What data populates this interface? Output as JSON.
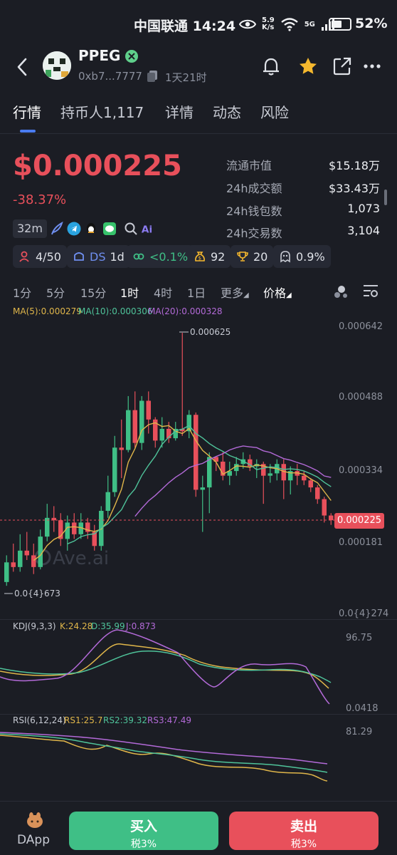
{
  "status_bar": {
    "carrier_time": "中国联通 14:24",
    "net_speed_top": "5.9",
    "net_speed_bottom": "K/s",
    "network": "5G",
    "battery": "52%"
  },
  "header": {
    "token_name": "PPEG",
    "address": "0xb7...7777",
    "age": "1天21时",
    "icons": [
      "back-icon",
      "bell-icon",
      "star-icon",
      "share-icon",
      "more-icon"
    ],
    "star_color": "#f5b82e"
  },
  "tabs": [
    {
      "label": "行情",
      "active": true
    },
    {
      "label": "持币人1,117",
      "active": false
    },
    {
      "label": "详情",
      "active": false
    },
    {
      "label": "动态",
      "active": false
    },
    {
      "label": "风险",
      "active": false
    }
  ],
  "price": {
    "value": "$0.000225",
    "change": "-38.37%",
    "color_down": "#e8505b",
    "color_up": "#3fbf86"
  },
  "stats": [
    {
      "label": "流通市值",
      "value": "$15.18万"
    },
    {
      "label": "24h成交额",
      "value": "$33.43万"
    },
    {
      "label": "24h钱包数",
      "value": "1,073"
    },
    {
      "label": "24h交易数",
      "value": "3,104"
    }
  ],
  "timeframe_badge": "32m",
  "social_icons": [
    "feather-icon",
    "telegram-icon",
    "qq-icon",
    "wechat-icon",
    "search-icon",
    "ai-icon"
  ],
  "chips": [
    {
      "icon": "holder-icon",
      "text": "4/50"
    },
    {
      "icon": "dev-icon",
      "text": "DS",
      "extra": "1d"
    },
    {
      "icon": "link-icon",
      "text": "<0.1%"
    },
    {
      "icon": "money-bag-icon",
      "text": "92"
    },
    {
      "icon": "trophy-icon",
      "text": "20"
    },
    {
      "icon": "ghost-icon",
      "text": "0.9%"
    }
  ],
  "intervals": [
    {
      "label": "1分",
      "active": false
    },
    {
      "label": "5分",
      "active": false
    },
    {
      "label": "15分",
      "active": false
    },
    {
      "label": "1时",
      "active": true
    },
    {
      "label": "4时",
      "active": false
    },
    {
      "label": "1日",
      "active": false
    },
    {
      "label": "更多",
      "active": false
    },
    {
      "label": "价格",
      "active": true
    }
  ],
  "ma_legend": {
    "ma5": "MA(5):0.000279",
    "ma10": "MA(10):0.000306",
    "ma20": "MA(20):0.000328",
    "ma5_color": "#e0b64a",
    "ma10_color": "#4fc39a",
    "ma20_color": "#b36ad8"
  },
  "watermark": "Ave.ai",
  "kdj_legend": {
    "title": "KDJ(9,3,3)",
    "k": "K:24.28",
    "d": "D:35.99",
    "j": "J:0.873"
  },
  "kdj_axis": {
    "top": "96.75",
    "bottom": "0.0418"
  },
  "rsi_legend": {
    "title": "RSI(6,12,24)",
    "rs1": "RS1:25.7",
    "rs2": "RS2:39.32",
    "rs3": "RS3:47.49"
  },
  "rsi_axis": {
    "top": "81.29"
  },
  "bottom": {
    "dapp": "DApp",
    "buy": "买入",
    "buy_tax": "税3%",
    "sell": "卖出",
    "sell_tax": "税3%",
    "buy_color": "#3fbf86",
    "sell_color": "#e8505b"
  },
  "chart_data": {
    "type": "candlestick",
    "y_axis_labels": [
      "0.000642",
      "0.000488",
      "0.000334",
      "0.000181",
      "0.0{4}274"
    ],
    "ylim": [
      2.74e-05,
      0.000642
    ],
    "high_label": "0.000625",
    "low_label": "0.0{4}673",
    "current_price_label": "0.000225",
    "candles": [
      [
        9.3e-05,
        0.000135,
        0.00015,
        8.5e-05
      ],
      [
        0.000135,
        0.000125,
        0.000175,
        0.000115
      ],
      [
        0.000125,
        0.00016,
        0.000195,
        0.000115
      ],
      [
        0.00016,
        0.00015,
        0.0002,
        0.00014
      ],
      [
        0.00015,
        0.000125,
        0.000175,
        0.00011
      ],
      [
        0.000125,
        0.00019,
        0.000205,
        0.00012
      ],
      [
        0.00019,
        0.00023,
        0.00026,
        0.00018
      ],
      [
        0.00023,
        0.000225,
        0.000255,
        0.0002
      ],
      [
        0.000225,
        0.000185,
        0.00024,
        0.00017
      ],
      [
        0.000185,
        0.00022,
        0.000235,
        0.00016
      ],
      [
        0.00022,
        0.000195,
        0.00024,
        0.000185
      ],
      [
        0.000195,
        0.00022,
        0.00024,
        0.000185
      ],
      [
        0.00022,
        0.0002,
        0.00023,
        0.000185
      ],
      [
        0.0002,
        0.00017,
        0.000215,
        0.00016
      ],
      [
        0.00017,
        0.000245,
        0.000255,
        0.00016
      ],
      [
        0.000245,
        0.000285,
        0.00032,
        0.00023
      ],
      [
        0.000285,
        0.00038,
        0.000405,
        0.000275
      ],
      [
        0.00038,
        0.000375,
        0.00044,
        0.000315
      ],
      [
        0.000375,
        0.00046,
        0.00049,
        0.00037
      ],
      [
        0.00046,
        0.00039,
        0.0005,
        0.00038
      ],
      [
        0.00039,
        0.00048,
        0.00049,
        0.000375
      ],
      [
        0.00048,
        0.00044,
        0.0005,
        0.00041
      ],
      [
        0.00044,
        0.000395,
        0.000445,
        0.00038
      ],
      [
        0.000395,
        0.00042,
        0.000445,
        0.00038
      ],
      [
        0.00042,
        0.0004,
        0.000435,
        0.00039
      ],
      [
        0.0004,
        0.00042,
        0.000435,
        0.000395
      ],
      [
        0.00042,
        0.000415,
        0.000625,
        0.000405
      ],
      [
        0.000415,
        0.00045,
        0.00046,
        0.0004
      ],
      [
        0.00045,
        0.00029,
        0.000455,
        0.000275
      ],
      [
        0.00029,
        0.000295,
        0.00032,
        0.0002
      ],
      [
        0.000295,
        0.00036,
        0.00037,
        0.00024
      ],
      [
        0.00036,
        0.00035,
        0.00036,
        0.00033
      ],
      [
        0.00035,
        0.00032,
        0.00037,
        0.00031
      ],
      [
        0.00032,
        0.00033,
        0.00035,
        0.0003
      ],
      [
        0.00033,
        0.000345,
        0.00036,
        0.00032
      ],
      [
        0.000345,
        0.000355,
        0.00037,
        0.000335
      ],
      [
        0.000355,
        0.00034,
        0.000365,
        0.00033
      ],
      [
        0.00034,
        0.000345,
        0.000355,
        0.000315
      ],
      [
        0.000345,
        0.00032,
        0.00035,
        0.00026
      ],
      [
        0.00032,
        0.000325,
        0.000345,
        0.000305
      ],
      [
        0.000325,
        0.000345,
        0.000355,
        0.00031
      ],
      [
        0.000345,
        0.00031,
        0.000355,
        0.00027
      ],
      [
        0.00031,
        0.00033,
        0.00034,
        0.00028
      ],
      [
        0.00033,
        0.00032,
        0.000345,
        0.0003
      ],
      [
        0.00032,
        0.00031,
        0.00033,
        0.0003
      ],
      [
        0.00031,
        0.000295,
        0.000315,
        0.000285
      ],
      [
        0.000295,
        0.00027,
        0.0003,
        0.00026
      ],
      [
        0.00027,
        0.000235,
        0.000275,
        0.00022
      ],
      [
        0.000235,
        0.000225,
        0.00024,
        0.000215
      ]
    ]
  }
}
